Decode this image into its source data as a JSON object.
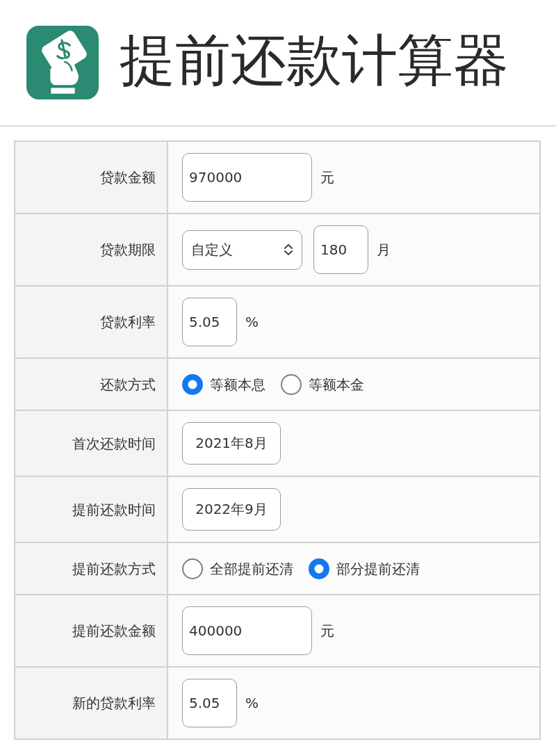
{
  "app": {
    "title": "提前还款计算器"
  },
  "form": {
    "rows": [
      {
        "kind": "amount",
        "label": "贷款金额",
        "value": "970000",
        "unit": "元"
      },
      {
        "kind": "term",
        "label": "贷款期限",
        "select": "自定义",
        "value": "180",
        "unit": "月"
      },
      {
        "kind": "rate",
        "label": "贷款利率",
        "value": "5.05",
        "unit": "%"
      },
      {
        "kind": "choice",
        "label": "还款方式",
        "options": [
          {
            "label": "等额本息",
            "selected": true
          },
          {
            "label": "等额本金",
            "selected": false
          }
        ]
      },
      {
        "kind": "date",
        "label": "首次还款时间",
        "value": "2021年8月"
      },
      {
        "kind": "date",
        "label": "提前还款时间",
        "value": "2022年9月"
      },
      {
        "kind": "choice",
        "label": "提前还款方式",
        "options": [
          {
            "label": "全部提前还清",
            "selected": false
          },
          {
            "label": "部分提前还清",
            "selected": true
          }
        ]
      },
      {
        "kind": "amount",
        "label": "提前还款金额",
        "value": "400000",
        "unit": "元"
      },
      {
        "kind": "rate",
        "label": "新的贷款利率",
        "value": "5.05",
        "unit": "%"
      }
    ]
  }
}
